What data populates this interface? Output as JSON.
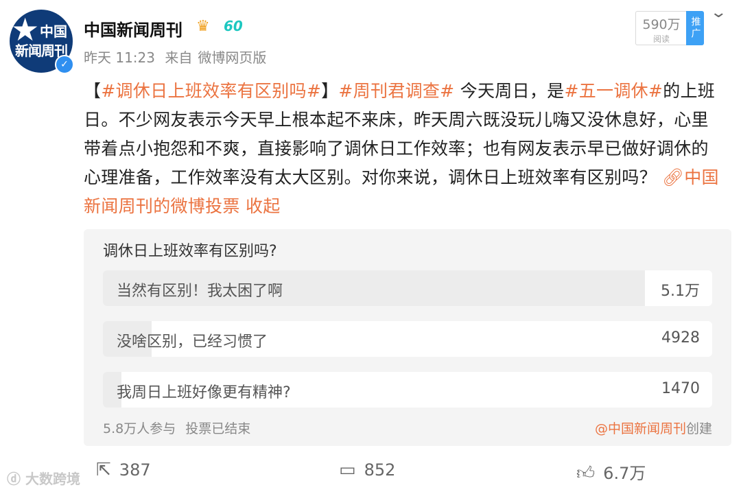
{
  "account": {
    "avatar_text_line1": "中国",
    "avatar_text_line2": "新闻周刊",
    "name": "中国新闻周刊",
    "time": "昨天 11:23",
    "source_prefix": "来自",
    "source": "微博网页版",
    "read_count": "590万",
    "read_label": "阅读",
    "promote_label": "推广"
  },
  "post": {
    "bracket_open": "【",
    "tag1": "#调休日上班效率有区别吗#",
    "bracket_close": "】",
    "tag2": "#周刊君调查#",
    "text1": " 今天周日，是",
    "tag3": "#五一调休#",
    "text2": "的上班日。不少网友表示今天早上根本起不来床，昨天周六既没玩儿嗨又没休息好，心里带着点小抱怨和不爽，直接影响了调休日工作效率；也有网友表示早已做好调休的心理准备，工作效率没有太大区别。对你来说，调休日上班效率有区别吗？ ",
    "link_text": "中国新闻周刊的微博投票",
    "collapse": " 收起"
  },
  "poll": {
    "title": "调休日上班效率有区别吗?",
    "options": [
      {
        "label": "当然有区别！我太困了啊",
        "count": "5.1万",
        "fraction": 0.89
      },
      {
        "label": "没啥区别，已经习惯了",
        "count": "4928",
        "fraction": 0.08
      },
      {
        "label": "我周日上班好像更有精神?",
        "count": "1470",
        "fraction": 0.03
      }
    ],
    "participants": "5.8万人参与",
    "status": "投票已结束",
    "creator_link": "@中国新闻周刊",
    "creator_suffix": "创建"
  },
  "actions": {
    "share_count": "387",
    "comment_count": "852",
    "like_count": "6.7万"
  },
  "watermark": "大数跨境"
}
